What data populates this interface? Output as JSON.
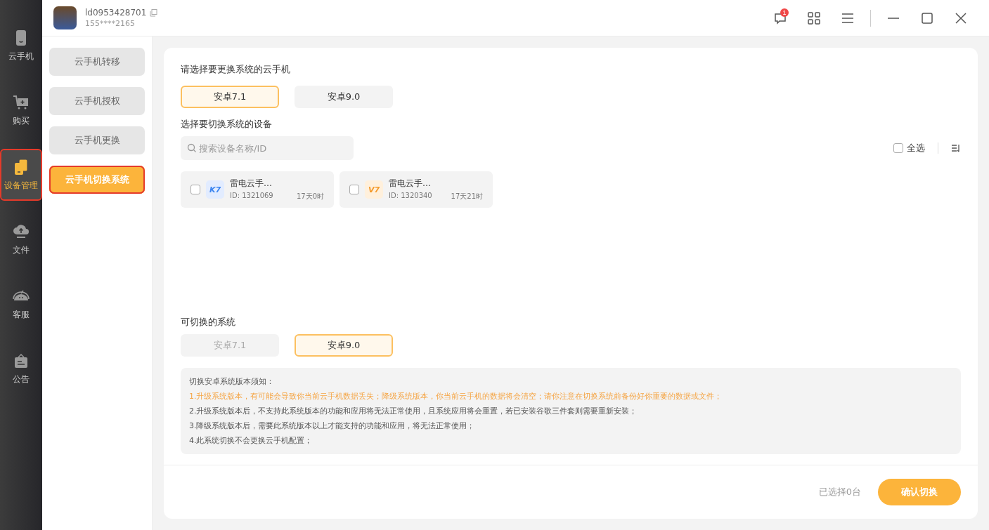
{
  "account": {
    "username": "ld0953428701",
    "phone": "155****2165"
  },
  "header": {
    "notification_count": "1"
  },
  "nav": [
    {
      "label": "云手机",
      "kind": "phone",
      "selected": false,
      "highlighted": false
    },
    {
      "label": "购买",
      "kind": "cart",
      "selected": false,
      "highlighted": false
    },
    {
      "label": "设备管理",
      "kind": "devices",
      "selected": true,
      "highlighted": true
    },
    {
      "label": "文件",
      "kind": "cloud",
      "selected": false,
      "highlighted": false
    },
    {
      "label": "客服",
      "kind": "support",
      "selected": false,
      "highlighted": false
    },
    {
      "label": "公告",
      "kind": "notice",
      "selected": false,
      "highlighted": false
    }
  ],
  "submenu": [
    {
      "label": "云手机转移",
      "selected": false,
      "highlighted": false
    },
    {
      "label": "云手机授权",
      "selected": false,
      "highlighted": false
    },
    {
      "label": "云手机更换",
      "selected": false,
      "highlighted": false
    },
    {
      "label": "云手机切换系统",
      "selected": true,
      "highlighted": true
    }
  ],
  "source_section": {
    "title": "请选择要更换系统的云手机",
    "options": [
      {
        "label": "安卓7.1",
        "selected": true
      },
      {
        "label": "安卓9.0",
        "selected": false
      }
    ]
  },
  "device_section": {
    "title": "选择要切换系统的设备",
    "search": {
      "placeholder": "搜索设备名称/ID"
    },
    "select_all": {
      "label": "全选",
      "checked": false
    },
    "devices": [
      {
        "badge": "K7",
        "kind": "blue",
        "name": "雷电云手…",
        "id": "ID: 1321069",
        "remaining": "17天0时",
        "checked": false
      },
      {
        "badge": "V7",
        "kind": "orange",
        "name": "雷电云手…",
        "id": "ID: 1320340",
        "remaining": "17天21时",
        "checked": false
      }
    ]
  },
  "target_section": {
    "title": "可切换的系统",
    "options": [
      {
        "label": "安卓7.1",
        "selected": false,
        "disabled": true
      },
      {
        "label": "安卓9.0",
        "selected": true,
        "disabled": false
      }
    ]
  },
  "notice": {
    "title": "切换安卓系统版本须知：",
    "lines": [
      {
        "text": "1.升级系统版本，有可能会导致你当前云手机数据丢失；降级系统版本，你当前云手机的数据将会清空；请你注意在切换系统前备份好你重要的数据或文件；",
        "kind": "warning"
      },
      {
        "text": "2.升级系统版本后，不支持此系统版本的功能和应用将无法正常使用，且系统应用将会重置，若已安装谷歌三件套则需要重新安装；",
        "kind": "normal"
      },
      {
        "text": "3.降级系统版本后，需要此系统版本以上才能支持的功能和应用，将无法正常使用；",
        "kind": "normal"
      },
      {
        "text": "4.此系统切换不会更换云手机配置；",
        "kind": "normal"
      }
    ]
  },
  "footer": {
    "selected_count": "已选择0台",
    "confirm_button": "确认切换"
  }
}
